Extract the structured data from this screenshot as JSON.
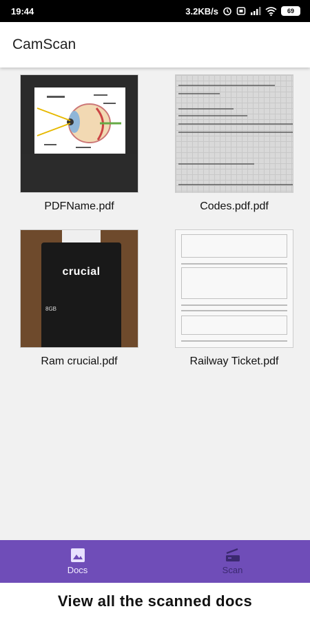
{
  "status_bar": {
    "time": "19:44",
    "network_speed": "3.2KB/s",
    "battery_level": "69",
    "icons": [
      "alarm-icon",
      "box-icon",
      "signal-icon",
      "wifi-icon",
      "battery-icon"
    ]
  },
  "app_bar": {
    "title": "CamScan"
  },
  "docs": [
    {
      "name": "PDFName.pdf",
      "thumbnail": "eye-diagram"
    },
    {
      "name": "Codes.pdf.pdf",
      "thumbnail": "handwritten-code"
    },
    {
      "name": "Ram crucial.pdf",
      "thumbnail": "ram-stick"
    },
    {
      "name": "Railway Ticket.pdf",
      "thumbnail": "railway-ticket"
    }
  ],
  "ram_thumb": {
    "brand": "crucial",
    "capacity": "8GB"
  },
  "bottom_nav": {
    "docs_label": "Docs",
    "scan_label": "Scan",
    "background": "#6f4db8"
  },
  "caption": "View all the scanned docs"
}
